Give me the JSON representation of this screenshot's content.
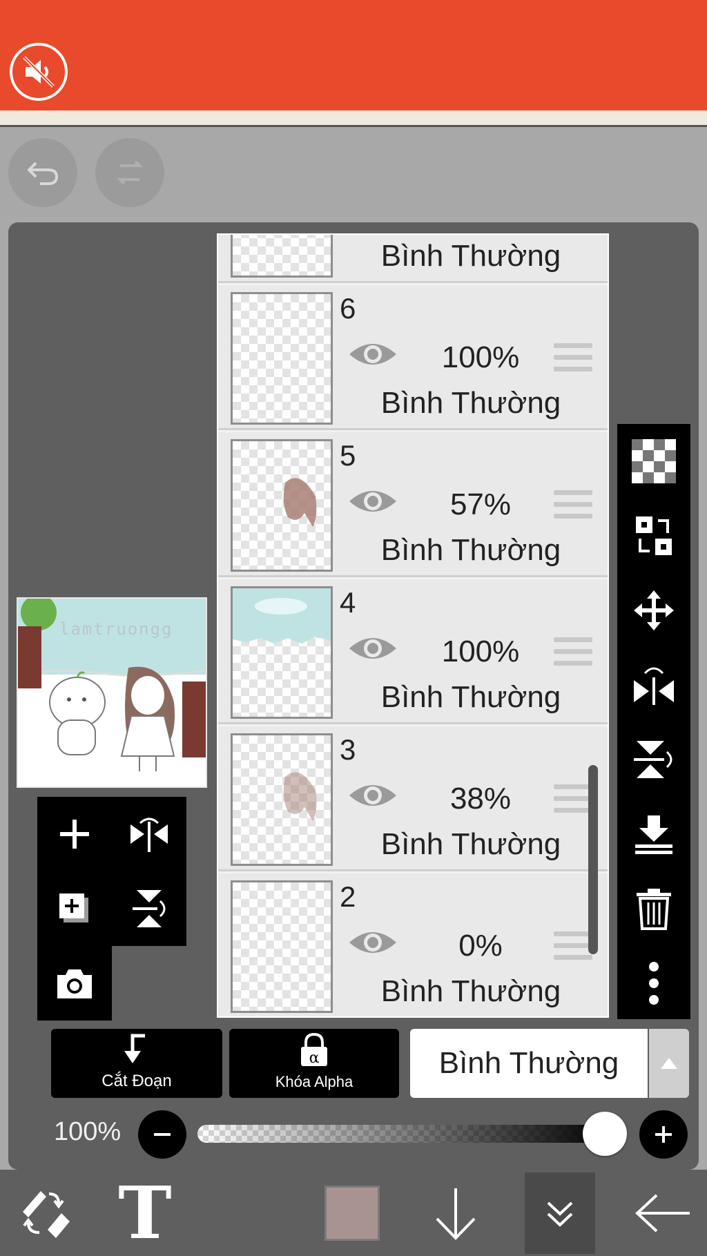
{
  "colors": {
    "topbar": "#e84a2b",
    "panel": "#5f5f5f",
    "current_color": "#a99391"
  },
  "icons": {
    "mute": "speaker-muted-icon",
    "undo": "undo-icon",
    "redo": "redo-icon"
  },
  "layers": [
    {
      "number": "",
      "opacity": "",
      "blend": "Bình Thường",
      "thumb": "sketch"
    },
    {
      "number": "6",
      "opacity": "100%",
      "blend": "Bình Thường",
      "thumb": "empty"
    },
    {
      "number": "5",
      "opacity": "57%",
      "blend": "Bình Thường",
      "thumb": "hair"
    },
    {
      "number": "4",
      "opacity": "100%",
      "blend": "Bình Thường",
      "thumb": "sky"
    },
    {
      "number": "3",
      "opacity": "38%",
      "blend": "Bình Thường",
      "thumb": "hair"
    },
    {
      "number": "2",
      "opacity": "0%",
      "blend": "Bình Thường",
      "thumb": "empty"
    }
  ],
  "thumbnail": {
    "watermark": "lamtruongg"
  },
  "bottom_controls": {
    "clipping_label": "Cắt Đoạn",
    "alpha_lock_label": "Khóa Alpha",
    "blend_mode": "Bình Thường"
  },
  "opacity": {
    "label": "100%",
    "value": 1.0
  },
  "bottom_bar": {
    "text_tool": "T"
  }
}
